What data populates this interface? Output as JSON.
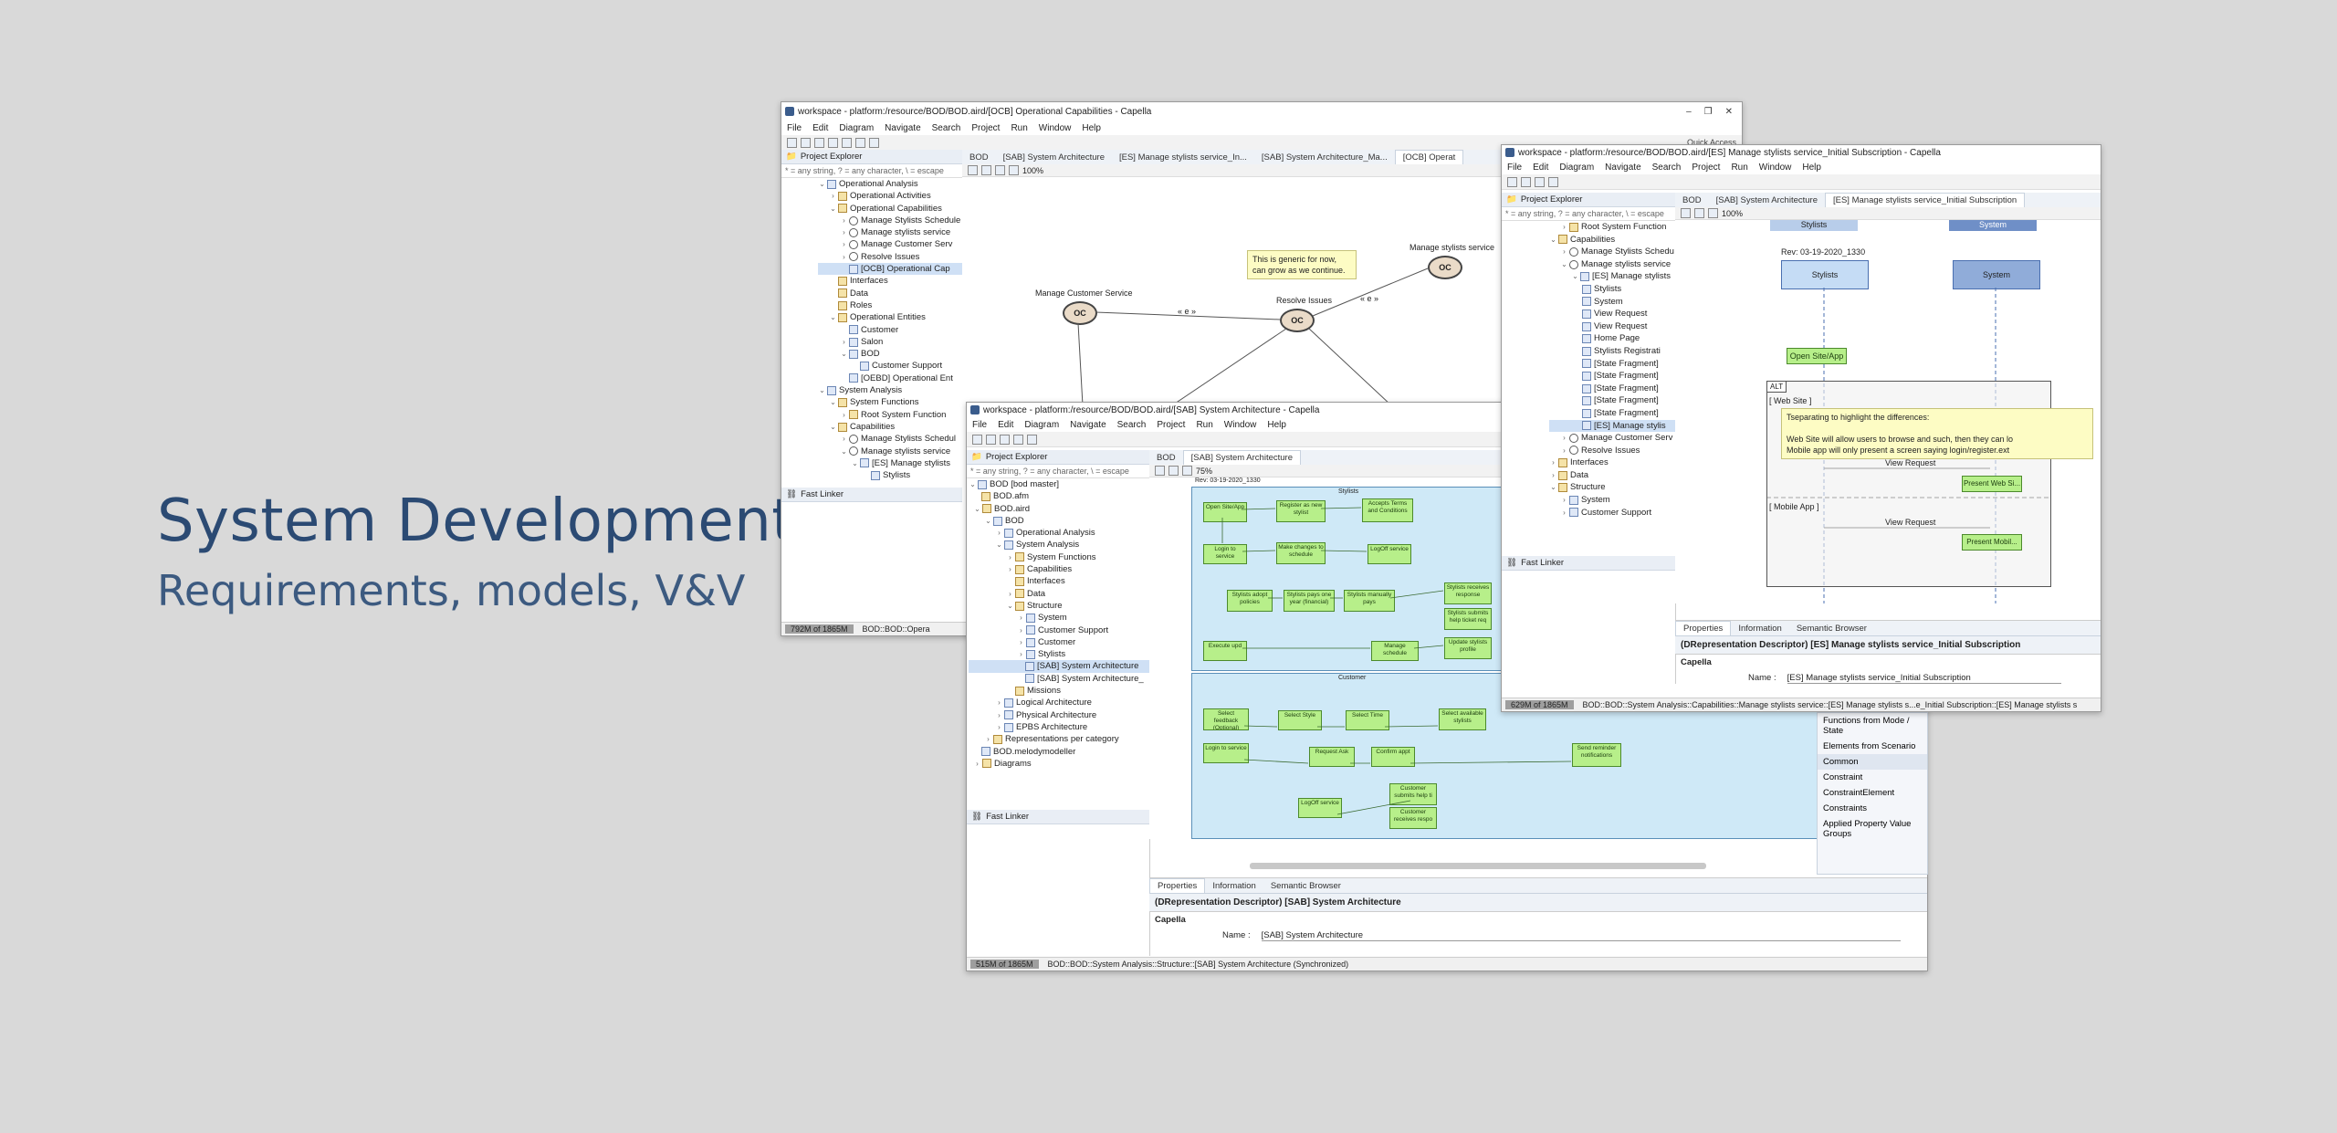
{
  "slide": {
    "title": "System Development",
    "subtitle": "Requirements, models, V&V"
  },
  "window1": {
    "title": "workspace - platform:/resource/BOD/BOD.aird/[OCB] Operational Capabilities - Capella",
    "menu": [
      "File",
      "Edit",
      "Diagram",
      "Navigate",
      "Search",
      "Project",
      "Run",
      "Window",
      "Help"
    ],
    "quick_access": "Quick Access",
    "explorer_label": "Project Explorer",
    "filter_placeholder": "* = any string, ? = any character, \\ = escape",
    "tree": [
      "Operational Analysis",
      "Operational Activities",
      "Operational Capabilities",
      "Manage Stylists Schedule",
      "Manage stylists service",
      "Manage Customer Serv",
      "Resolve Issues",
      "[OCB] Operational Cap",
      "Interfaces",
      "Data",
      "Roles",
      "Operational Entities",
      "Customer",
      "Salon",
      "BOD",
      "Customer Support",
      "[OEBD] Operational Ent",
      "System Analysis",
      "System Functions",
      "Root System Function",
      "Capabilities",
      "Manage Stylists Schedul",
      "Manage stylists service",
      "[ES] Manage stylists",
      "Stylists"
    ],
    "fast_linker": "Fast Linker",
    "tabs": [
      "BOD",
      "[SAB] System Architecture",
      "[ES] Manage stylists service_In...",
      "[SAB] System Architecture_Ma...",
      "[OCB] Operat"
    ],
    "zoom": "100%",
    "diagram": {
      "note": [
        "This is generic for now,",
        "can grow as we continue."
      ],
      "nodes": [
        "Manage Customer Service",
        "Resolve Issues",
        "Manage stylists service"
      ],
      "oc_label": "OC",
      "edge_label": "« e »"
    },
    "heap": "792M of 1865M",
    "status_path": "BOD::BOD::Opera"
  },
  "window2": {
    "title": "workspace - platform:/resource/BOD/BOD.aird/[SAB] System Architecture - Capella",
    "menu": [
      "File",
      "Edit",
      "Diagram",
      "Navigate",
      "Search",
      "Project",
      "Run",
      "Window",
      "Help"
    ],
    "explorer_label": "Project Explorer",
    "filter_placeholder": "* = any string, ? = any character, \\ = escape",
    "tree": [
      "BOD [bod master]",
      "BOD.afm",
      "BOD.aird",
      "BOD",
      "Operational Analysis",
      "System Analysis",
      "System Functions",
      "Capabilities",
      "Interfaces",
      "Data",
      "Structure",
      "System",
      "Customer Support",
      "Customer",
      "Stylists",
      "[SAB] System Architecture",
      "[SAB] System Architecture_",
      "Missions",
      "Logical Architecture",
      "Physical Architecture",
      "EPBS Architecture",
      "Representations per category",
      "BOD.melodymodeller",
      "Diagrams"
    ],
    "fast_linker": "Fast Linker",
    "tabs": [
      "BOD",
      "[SAB] System Architecture"
    ],
    "zoom": "75%",
    "rev": "Rev: 03-19-2020_1330",
    "section_labels": [
      "Stylists",
      "Customer"
    ],
    "functions": [
      "Open Site/App",
      "Register as new stylist",
      "Accepts Terms and Conditions",
      "Login to service",
      "Make changes to schedule",
      "LogOff service",
      "Stylists adopt policies",
      "Stylists pays one year (financial)",
      "Stylists manually pays",
      "Stylists receives response",
      "Stylists submits help ticket req",
      "Execute upd",
      "Manage schedule",
      "Update stylists profile",
      "Select feedback (Optional)",
      "Select Style",
      "Select Time",
      "Select available stylists",
      "Login to service",
      "Request Ask",
      "Confirm appt",
      "Send reminder notifications",
      "Customer submits help ti",
      "Customer receives respo",
      "LogOff service"
    ],
    "props_tabs": [
      "Properties",
      "Information",
      "Semantic Browser"
    ],
    "props_title": "(DRepresentation Descriptor)  [SAB] System Architecture",
    "props_section": "Capella",
    "props_name_label": "Name :",
    "props_name_value": "[SAB] System Architecture",
    "heap": "515M of 1865M",
    "status_path": "BOD::BOD::System Analysis::Structure::[SAB] System Architecture (Synchronized)"
  },
  "window3": {
    "title": "workspace - platform:/resource/BOD/BOD.aird/[ES] Manage stylists service_Initial Subscription - Capella",
    "menu": [
      "File",
      "Edit",
      "Diagram",
      "Navigate",
      "Search",
      "Project",
      "Run",
      "Window",
      "Help"
    ],
    "explorer_label": "Project Explorer",
    "filter_placeholder": "* = any string, ? = any character, \\ = escape",
    "tree": [
      "Root System Function",
      "Capabilities",
      "Manage Stylists Schedu",
      "Manage stylists service",
      "[ES] Manage stylists",
      "Stylists",
      "System",
      "View Request",
      "View Request",
      "Home Page",
      "Stylists Registrati",
      "[State Fragment]",
      "[State Fragment]",
      "[State Fragment]",
      "[State Fragment]",
      "[State Fragment]",
      "[ES] Manage stylis",
      "Manage Customer Serv",
      "Resolve Issues",
      "Interfaces",
      "Data",
      "Structure",
      "System",
      "Customer Support"
    ],
    "fast_linker": "Fast Linker",
    "tabs": [
      "BOD",
      "[SAB] System Architecture",
      "[ES] Manage stylists service_Initial Subscription"
    ],
    "zoom": "100%",
    "lane_headers": [
      "Stylists",
      "System"
    ],
    "rev": "Rev: 03-19-2020_1330",
    "lifelines": [
      "Stylists",
      "System"
    ],
    "open_site": "Open Site/App",
    "alt_label": "ALT",
    "web_site": "[ Web Site ]",
    "mobile_app": "[ Mobile App ]",
    "note": [
      "Tseparating to highlight the differences:",
      "",
      "Web Site will allow users to browse and such, then they can lo",
      "Mobile app will only present a screen saying login/register.ext"
    ],
    "view_request": "View Request",
    "present_web": "Present Web Si...",
    "present_mobile": "Present Mobil...",
    "props_tabs": [
      "Properties",
      "Information",
      "Semantic Browser"
    ],
    "props_title": "(DRepresentation Descriptor)  [ES] Manage stylists service_Initial Subscription",
    "props_section": "Capella",
    "props_name_label": "Name :",
    "props_name_value": "[ES] Manage stylists service_Initial Subscription",
    "heap": "629M of 1865M",
    "status_path": "BOD::BOD::System Analysis::Capabilities::Manage stylists service::[ES] Manage stylists s...e_Initial Subscription::[ES] Manage stylists s"
  },
  "palette": {
    "items_top": [
      "Functions from Mode / State",
      "Elements from Scenario"
    ],
    "section": "Common",
    "items": [
      "Constraint",
      "ConstraintElement",
      "Constraints",
      "Applied Property Value Groups"
    ]
  }
}
